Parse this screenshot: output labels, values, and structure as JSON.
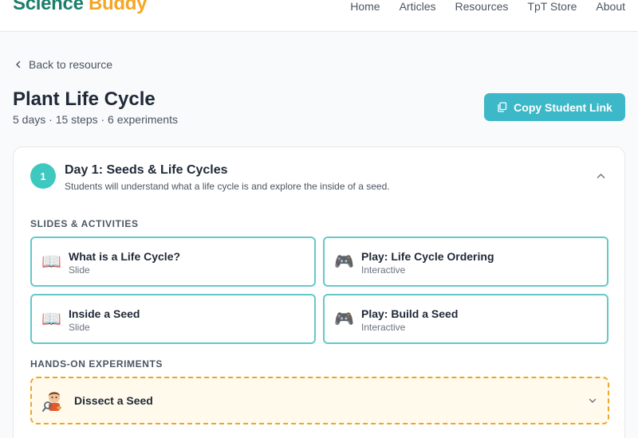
{
  "brand": {
    "part1": "Science",
    "part2": "Buddy"
  },
  "nav": [
    "Home",
    "Articles",
    "Resources",
    "TpT Store",
    "About"
  ],
  "back_label": "Back to resource",
  "page": {
    "title": "Plant Life Cycle",
    "subtitle": "5 days · 15 steps · 6 experiments",
    "copy_button": "Copy Student Link"
  },
  "day": {
    "number": "1",
    "title": "Day 1: Seeds & Life Cycles",
    "description": "Students will understand what a life cycle is and explore the inside of a seed."
  },
  "sections": {
    "slides": "SLIDES & ACTIVITIES",
    "experiments": "HANDS-ON EXPERIMENTS"
  },
  "items": [
    {
      "icon": "book-icon",
      "glyph": "📖",
      "name": "What is a Life Cycle?",
      "type": "Slide"
    },
    {
      "icon": "gamepad-icon",
      "glyph": "🎮",
      "name": "Play: Life Cycle Ordering",
      "type": "Interactive"
    },
    {
      "icon": "book-icon",
      "glyph": "📖",
      "name": "Inside a Seed",
      "type": "Slide"
    },
    {
      "icon": "gamepad-icon",
      "glyph": "🎮",
      "name": "Play: Build a Seed",
      "type": "Interactive"
    }
  ],
  "experiments": [
    {
      "icon": "scientist-icon",
      "name": "Dissect a Seed"
    }
  ],
  "colors": {
    "brand_green": "#1a7f6b",
    "brand_orange": "#f5a623",
    "accent_teal": "#3cb8c8",
    "tile_border": "#64c9c8",
    "experiment_border": "#f0a524",
    "experiment_bg": "#fffaeb"
  }
}
